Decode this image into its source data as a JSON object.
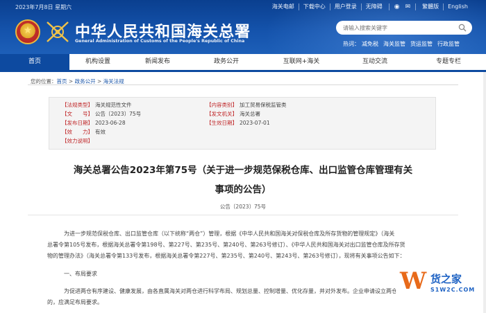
{
  "topbar": {
    "date": "2023年7月8日 星期六",
    "links": [
      "海关电邮",
      "下载中心",
      "用户登录",
      "无障碍"
    ],
    "lang_links": [
      "繁體版",
      "English"
    ]
  },
  "header": {
    "title": "中华人民共和国海关总署",
    "subtitle": "General Administration of Customs of the People's Republic of China",
    "search_placeholder": "请输入搜索关键字",
    "hot_label": "热词：",
    "hot_words": [
      "减免税",
      "海关监管",
      "货运监管",
      "行政监管"
    ]
  },
  "nav": {
    "items": [
      "首页",
      "机构设置",
      "新闻发布",
      "政务公开",
      "互联网+海关",
      "互动交流",
      "专题专栏"
    ],
    "active_index": 0
  },
  "breadcrumb": {
    "prefix": "您的位置：",
    "items": [
      "首页",
      "政务公开",
      "海关法规"
    ],
    "separator": ">"
  },
  "meta": {
    "rows": [
      {
        "label": "【法规类型】",
        "value": "海关规范性文件"
      },
      {
        "label": "【内容类别】",
        "value": "加工贸易保税监管类"
      },
      {
        "label": "【文　　号】",
        "value": "公告〔2023〕75号"
      },
      {
        "label": "【发文机关】",
        "value": "海关总署"
      },
      {
        "label": "【发布日期】",
        "value": "2023-06-28"
      },
      {
        "label": "【生效日期】",
        "value": "2023-07-01"
      },
      {
        "label": "【效　　力】",
        "value": "有效"
      },
      {
        "label": "【效力说明】",
        "value": ""
      }
    ]
  },
  "article": {
    "title_line1": "海关总署公告2023年第75号（关于进一步规范保税仓库、出口监管仓库管理有关",
    "title_line2": "事项的公告）",
    "doc_no": "公告〔2023〕75号",
    "paragraphs": [
      "为进一步规范保税仓库、出口监管仓库（以下统称“两仓”）管理，根据《中华人民共和国海关对保税仓库及所存货物的管理规定》（海关",
      "总署令第105号发布，根据海关总署令第198号、第227号、第235号、第240号、第263号修订）、《中华人民共和国海关对出口监管仓库及所存货",
      "物的管理办法》（海关总署令第133号发布，根据海关总署令第227号、第235号、第240号、第243号、第263号修订），现将有关事项公告如下：",
      "一、布局要求",
      "为促进两仓有序建设、健康发展，由各直属海关对两仓进行科学布局、规划总量、控制增量、优化存量，并对外发布。企业申请设立两仓",
      "的，应满足布局要求。"
    ]
  },
  "watermark": {
    "letter": "W",
    "name": "货之家",
    "url": "S1W2C.COM"
  },
  "colors": {
    "header_blue": "#0d4aa0",
    "label_red": "#c0282a",
    "link_blue": "#1a55a8"
  }
}
